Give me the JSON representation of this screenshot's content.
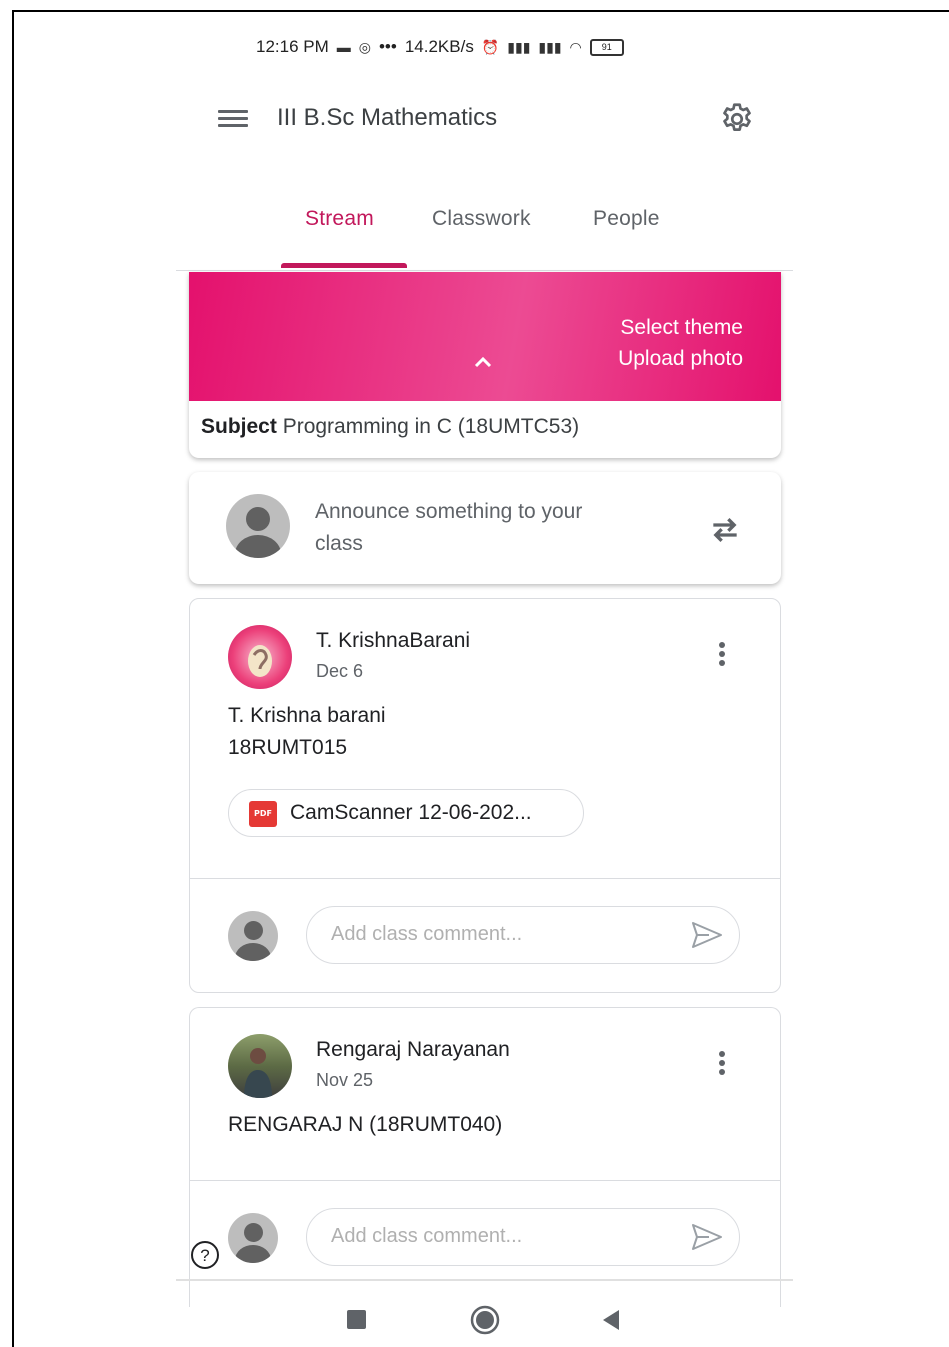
{
  "status_bar": {
    "time": "12:16 PM",
    "speed": "14.2KB/s",
    "more": "•••",
    "battery": "91"
  },
  "app_bar": {
    "title": "III B.Sc Mathematics",
    "menu_icon": "hamburger-menu-icon",
    "settings_icon": "gear-icon"
  },
  "tabs": [
    {
      "label": "Stream",
      "active": true
    },
    {
      "label": "Classwork",
      "active": false
    },
    {
      "label": "People",
      "active": false
    }
  ],
  "banner": {
    "select_theme": "Select theme",
    "upload_photo": "Upload photo",
    "subject_label": "Subject",
    "subject_value": "Programming in C (18UMTC53)",
    "gradient_color": "#e4116d"
  },
  "announce": {
    "placeholder": "Announce something to your class"
  },
  "posts": [
    {
      "author": "T. KrishnaBarani",
      "date": "Dec 6",
      "body_line1": "T. Krishna barani",
      "body_line2": "18RUMT015",
      "attachment": "CamScanner 12-06-202...",
      "attachment_type": "PDF",
      "comment_placeholder": "Add class comment..."
    },
    {
      "author": "Rengaraj Narayanan",
      "date": "Nov 25",
      "body_line1": "RENGARAJ N (18RUMT040)",
      "comment_placeholder": "Add class comment..."
    }
  ],
  "help": {
    "glyph": "?"
  },
  "accent_color": "#c2185b"
}
